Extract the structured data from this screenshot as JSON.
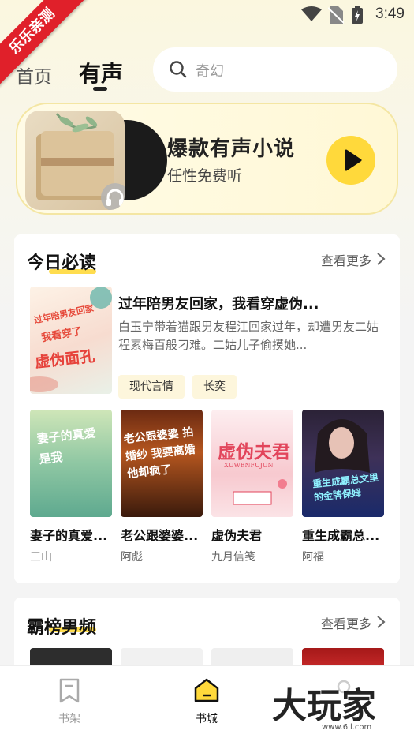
{
  "status_bar": {
    "time": "3:49"
  },
  "ribbon": {
    "label": "乐乐亲测"
  },
  "header": {
    "tabs": [
      {
        "label": "首页"
      },
      {
        "label": "有声"
      }
    ],
    "search": {
      "placeholder": "奇幻"
    }
  },
  "banner": {
    "title": "爆款有声小说",
    "subtitle": "任性免费听"
  },
  "section_daily": {
    "title": "今日必读",
    "more_label": "查看更多",
    "featured": {
      "title": "过年陪男友回家，我看穿虚伪...",
      "description": "白玉宁带着猫跟男友程江回家过年，却遭男友二姑程素梅百般刁难。二姑儿子偷摸她...",
      "cover_text": [
        "过年陪男友回家",
        "我看穿了",
        "虚伪面孔"
      ],
      "tags": [
        "现代言情",
        "长奕"
      ]
    },
    "books": [
      {
        "title": "妻子的真爱...",
        "author": "三山",
        "cover_text": "妻子的真爱是我"
      },
      {
        "title": "老公跟婆婆...",
        "author": "阿彪",
        "cover_text": "老公跟婆婆 拍婚纱 我要离婚 他却疯了"
      },
      {
        "title": "虚伪夫君",
        "author": "九月信笺",
        "cover_text": "虚伪夫君",
        "cover_subtext": "XUWENFUJUN"
      },
      {
        "title": "重生成霸总...",
        "author": "阿福",
        "cover_text": "重生成霸总文里的金牌保姆"
      }
    ]
  },
  "section_male": {
    "title": "霸榜男频",
    "more_label": "查看更多"
  },
  "bottom_nav": {
    "items": [
      {
        "label": "书架"
      },
      {
        "label": "书城"
      },
      {
        "label": ""
      }
    ]
  },
  "watermark": {
    "text": "大玩家",
    "sub": "www.6ll.com"
  },
  "colors": {
    "accent": "#ffd93b",
    "ribbon": "#e0202a",
    "tag_bg": "#fdf6dc"
  }
}
